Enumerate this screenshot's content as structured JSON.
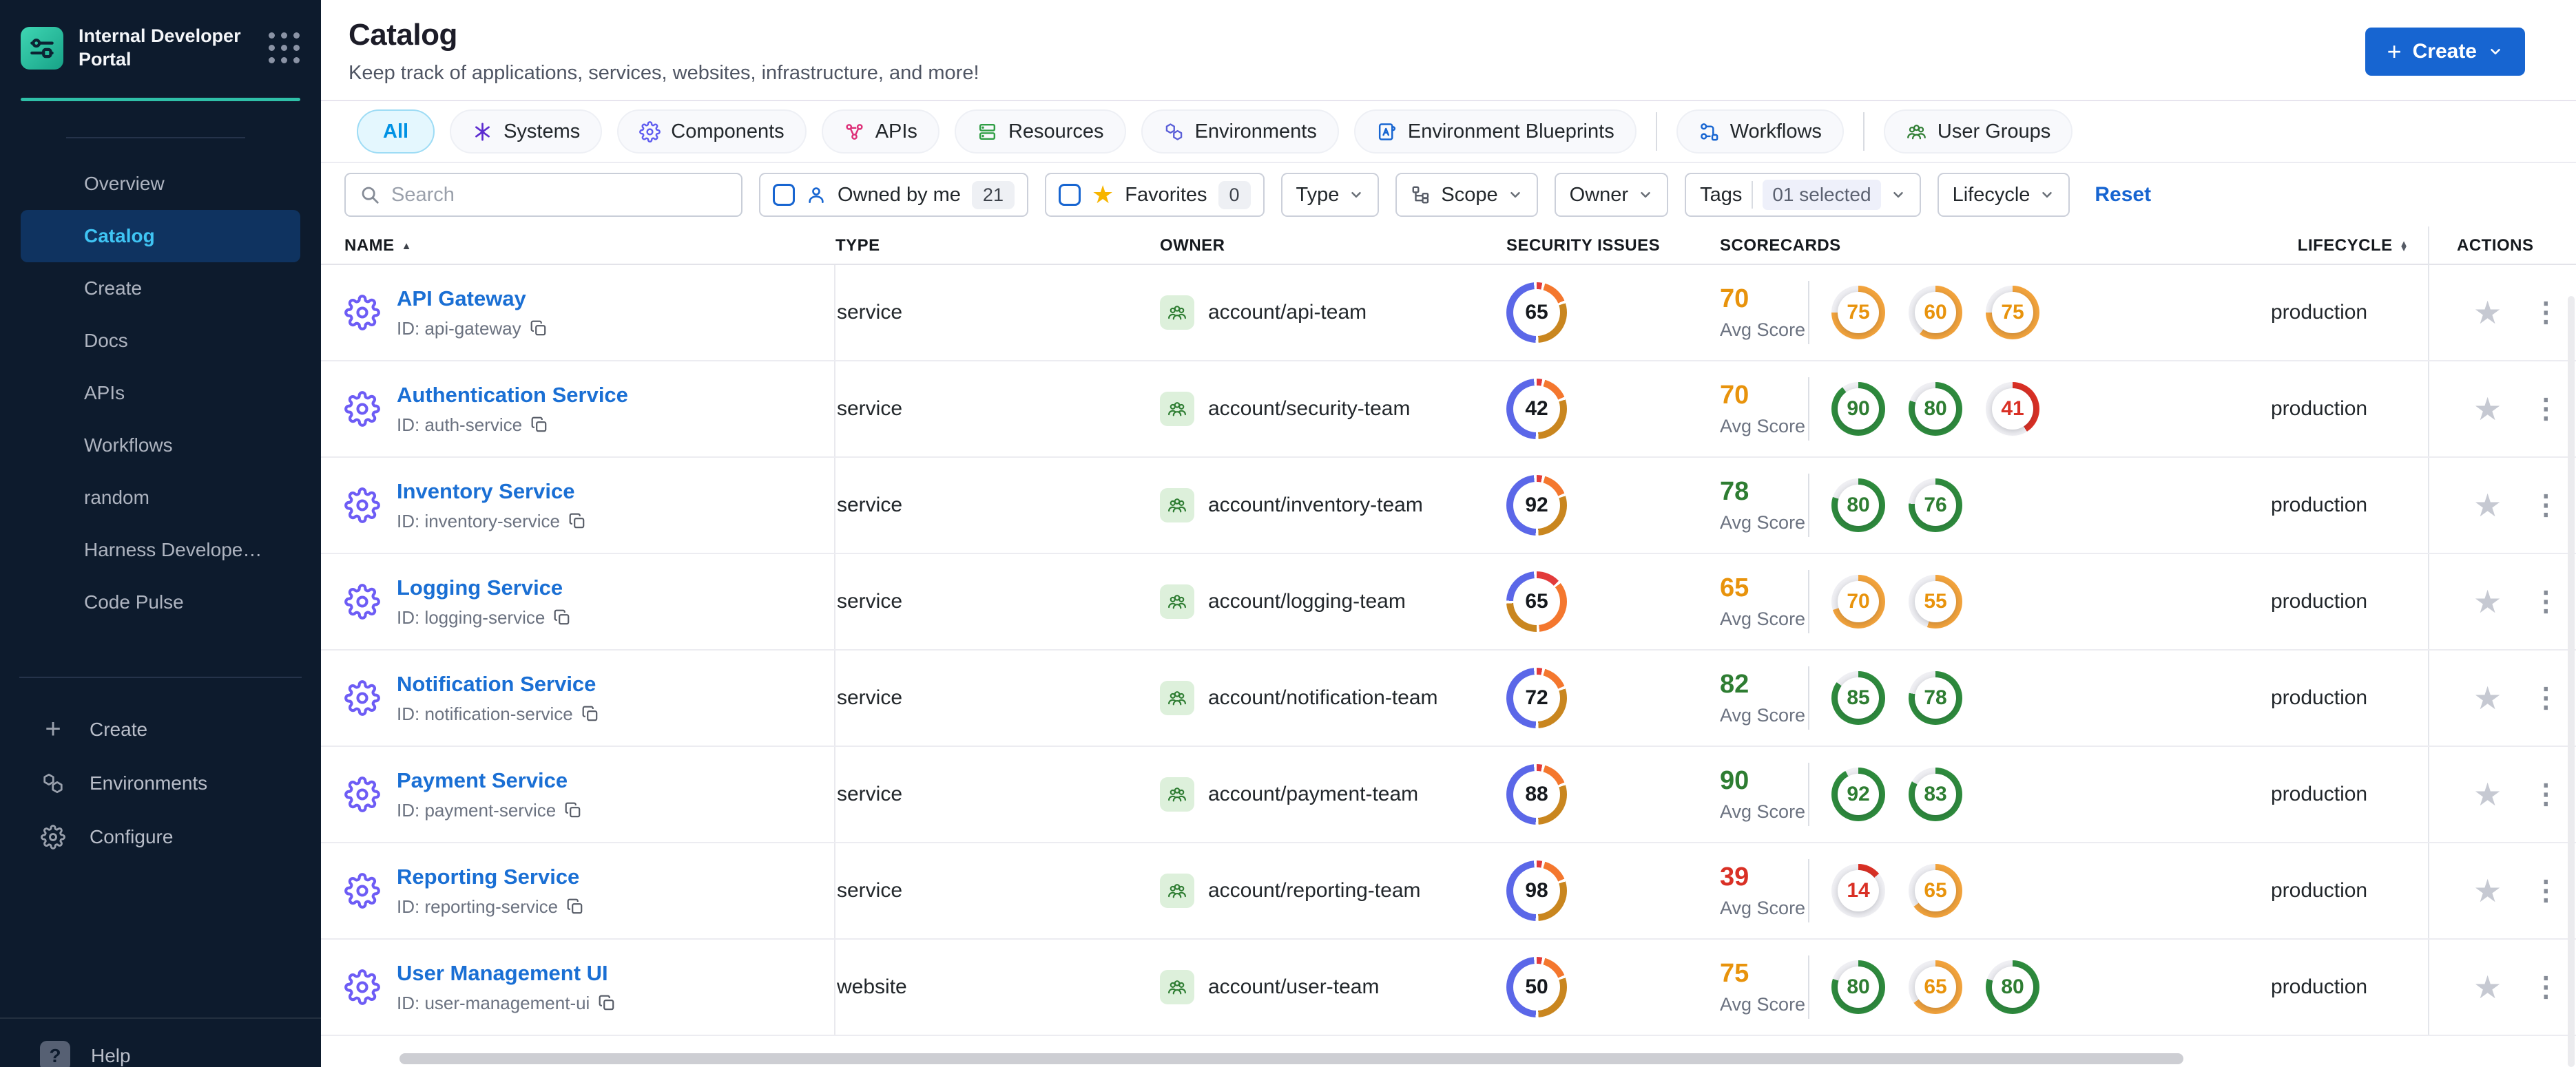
{
  "app": {
    "brand": "Internal Developer Portal"
  },
  "sidebar": {
    "nav": [
      "Overview",
      "Catalog",
      "Create",
      "Docs",
      "APIs",
      "Workflows",
      "random",
      "Harness Develope…",
      "Code Pulse"
    ],
    "active": "Catalog",
    "bottom": [
      {
        "label": "Create",
        "icon": "plus-icon"
      },
      {
        "label": "Environments",
        "icon": "hexagons-icon"
      },
      {
        "label": "Configure",
        "icon": "gear-icon"
      }
    ],
    "help_label": "Help"
  },
  "header": {
    "title": "Catalog",
    "subtitle": "Keep track of applications, services, websites, infrastructure, and more!",
    "create_label": "Create"
  },
  "tabs": [
    {
      "label": "All",
      "active": true
    },
    {
      "label": "Systems",
      "icon": "systems",
      "icon_color": "#5c2bd0"
    },
    {
      "label": "Components",
      "icon": "gear",
      "icon_color": "#5f5cf0"
    },
    {
      "label": "APIs",
      "icon": "apis",
      "icon_color": "#dd2e77"
    },
    {
      "label": "Resources",
      "icon": "resources",
      "icon_color": "#2f9e44"
    },
    {
      "label": "Environments",
      "icon": "hexagons",
      "icon_color": "#5a5fd8"
    },
    {
      "label": "Environment Blueprints",
      "icon": "blueprint",
      "icon_color": "#1765d1"
    },
    {
      "divider": true
    },
    {
      "label": "Workflows",
      "icon": "workflow",
      "icon_color": "#1765d1"
    },
    {
      "divider": true
    },
    {
      "label": "User Groups",
      "icon": "users",
      "icon_color": "#2e7d32"
    }
  ],
  "filters": {
    "search_placeholder": "Search",
    "owned": {
      "label": "Owned by me",
      "count": "21"
    },
    "favorites": {
      "label": "Favorites",
      "count": "0"
    },
    "type": {
      "label": "Type"
    },
    "scope": {
      "label": "Scope"
    },
    "owner": {
      "label": "Owner"
    },
    "tags": {
      "label": "Tags",
      "selected": "01 selected"
    },
    "lifecycle": {
      "label": "Lifecycle"
    },
    "reset": "Reset"
  },
  "colors": {
    "green": "#2e7d32",
    "green_ring": "#2e8b3d",
    "orange": "#e8930c",
    "orange_ring": "#f2a33c",
    "red": "#d93025",
    "red_ring": "#d93025",
    "donut_blue": "#5b67e8",
    "donut_red": "#e23b3b",
    "donut_orange": "#f4772e",
    "donut_gold": "#c9861f",
    "accent_blue": "#1765d1",
    "active_tab": "#0092e4",
    "teal": "#2fc0a8"
  },
  "donut_segments": {
    "std": [
      {
        "color": "donut_red",
        "pct": 3
      },
      {
        "color": "donut_orange",
        "pct": 14
      },
      {
        "color": "donut_gold",
        "pct": 29
      },
      {
        "color": "donut_blue",
        "pct": 48
      }
    ],
    "alt": [
      {
        "color": "donut_red",
        "pct": 13
      },
      {
        "color": "donut_orange",
        "pct": 34
      },
      {
        "color": "donut_gold",
        "pct": 24
      },
      {
        "color": "donut_blue",
        "pct": 23
      }
    ]
  },
  "table": {
    "columns": [
      {
        "label": "NAME",
        "sort": "asc"
      },
      {
        "label": "TYPE"
      },
      {
        "label": "OWNER"
      },
      {
        "label": "SECURITY ISSUES"
      },
      {
        "label": "SCORECARDS"
      },
      {
        "label": "LIFECYCLE",
        "sort": "both",
        "align": "right"
      },
      {
        "label": "ACTIONS",
        "sticky": true
      }
    ],
    "avg_label": "Avg Score",
    "rows": [
      {
        "name": "API Gateway",
        "id": "ID: api-gateway",
        "type": "service",
        "owner": "account/api-team",
        "security": 65,
        "segments": "std",
        "avg": 70,
        "avg_level": "orange",
        "scorecards": [
          {
            "value": 75,
            "level": "orange"
          },
          {
            "value": 60,
            "level": "orange"
          },
          {
            "value": 75,
            "level": "orange"
          }
        ],
        "lifecycle": "production"
      },
      {
        "name": "Authentication Service",
        "id": "ID: auth-service",
        "type": "service",
        "owner": "account/security-team",
        "security": 42,
        "segments": "std",
        "avg": 70,
        "avg_level": "orange",
        "scorecards": [
          {
            "value": 90,
            "level": "green"
          },
          {
            "value": 80,
            "level": "green"
          },
          {
            "value": 41,
            "level": "red"
          }
        ],
        "lifecycle": "production"
      },
      {
        "name": "Inventory Service",
        "id": "ID: inventory-service",
        "type": "service",
        "owner": "account/inventory-team",
        "security": 92,
        "segments": "std",
        "avg": 78,
        "avg_level": "green",
        "scorecards": [
          {
            "value": 80,
            "level": "green"
          },
          {
            "value": 76,
            "level": "green"
          }
        ],
        "lifecycle": "production"
      },
      {
        "name": "Logging Service",
        "id": "ID: logging-service",
        "type": "service",
        "owner": "account/logging-team",
        "security": 65,
        "segments": "alt",
        "avg": 65,
        "avg_level": "orange",
        "scorecards": [
          {
            "value": 70,
            "level": "orange"
          },
          {
            "value": 55,
            "level": "orange"
          }
        ],
        "lifecycle": "production"
      },
      {
        "name": "Notification Service",
        "id": "ID: notification-service",
        "type": "service",
        "owner": "account/notification-team",
        "security": 72,
        "segments": "std",
        "avg": 82,
        "avg_level": "green",
        "scorecards": [
          {
            "value": 85,
            "level": "green"
          },
          {
            "value": 78,
            "level": "green"
          }
        ],
        "lifecycle": "production"
      },
      {
        "name": "Payment Service",
        "id": "ID: payment-service",
        "type": "service",
        "owner": "account/payment-team",
        "security": 88,
        "segments": "std",
        "avg": 90,
        "avg_level": "green",
        "scorecards": [
          {
            "value": 92,
            "level": "green"
          },
          {
            "value": 83,
            "level": "green"
          }
        ],
        "lifecycle": "production"
      },
      {
        "name": "Reporting Service",
        "id": "ID: reporting-service",
        "type": "service",
        "owner": "account/reporting-team",
        "security": 98,
        "segments": "std",
        "avg": 39,
        "avg_level": "red",
        "scorecards": [
          {
            "value": 14,
            "level": "red"
          },
          {
            "value": 65,
            "level": "orange"
          }
        ],
        "lifecycle": "production"
      },
      {
        "name": "User Management UI",
        "id": "ID: user-management-ui",
        "type": "website",
        "owner": "account/user-team",
        "security": 50,
        "segments": "std",
        "avg": 75,
        "avg_level": "orange",
        "scorecards": [
          {
            "value": 80,
            "level": "green"
          },
          {
            "value": 65,
            "level": "orange"
          },
          {
            "value": 80,
            "level": "green"
          }
        ],
        "lifecycle": "production"
      }
    ]
  }
}
